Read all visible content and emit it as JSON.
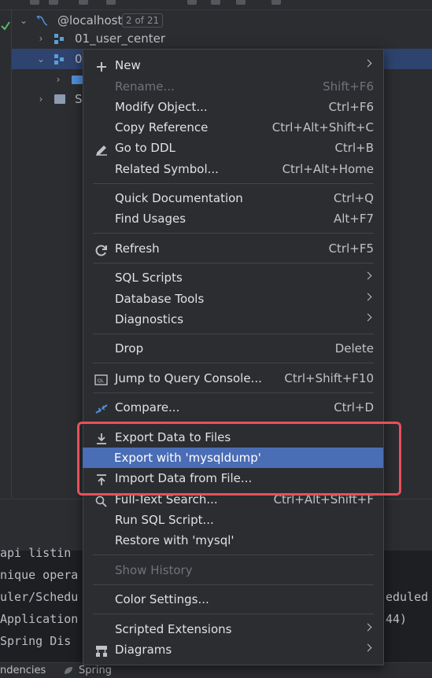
{
  "tree": {
    "datasource": {
      "name": "@localhost",
      "badge": "2 of 21"
    },
    "items": [
      {
        "label": "01_user_center"
      },
      {
        "label": "0"
      },
      {
        "label": ""
      },
      {
        "label": "S"
      }
    ]
  },
  "console": {
    "lines": [
      "  api listin",
      "nique opera",
      "uler/Schedu",
      " Application",
      "  Spring Dis"
    ],
    "right_fragments": [
      "eduled",
      "44)"
    ]
  },
  "statusbar": {
    "left_tab": "ndencies",
    "spring_tab": "Spring"
  },
  "context_menu": {
    "items": [
      {
        "label": "New",
        "shortcut": "",
        "submenu": true
      },
      {
        "label": "Rename...",
        "shortcut": "Shift+F6",
        "disabled": true
      },
      {
        "label": "Modify Object...",
        "shortcut": "Ctrl+F6"
      },
      {
        "label": "Copy Reference",
        "shortcut": "Ctrl+Alt+Shift+C"
      },
      {
        "label": "Go to DDL",
        "shortcut": "Ctrl+B"
      },
      {
        "label": "Related Symbol...",
        "shortcut": "Ctrl+Alt+Home"
      },
      {
        "label": "Quick Documentation",
        "shortcut": "Ctrl+Q"
      },
      {
        "label": "Find Usages",
        "shortcut": "Alt+F7"
      },
      {
        "label": "Refresh",
        "shortcut": "Ctrl+F5"
      },
      {
        "label": "SQL Scripts",
        "shortcut": "",
        "submenu": true
      },
      {
        "label": "Database Tools",
        "shortcut": "",
        "submenu": true
      },
      {
        "label": "Diagnostics",
        "shortcut": "",
        "submenu": true
      },
      {
        "label": "Drop",
        "shortcut": "Delete"
      },
      {
        "label": "Jump to Query Console...",
        "shortcut": "Ctrl+Shift+F10"
      },
      {
        "label": "Compare...",
        "shortcut": "Ctrl+D"
      },
      {
        "label": "Export Data to Files",
        "shortcut": ""
      },
      {
        "label": "Export with 'mysqldump'",
        "shortcut": "",
        "highlighted": true
      },
      {
        "label": "Import Data from File...",
        "shortcut": ""
      },
      {
        "label": "Full-Text Search...",
        "shortcut": "Ctrl+Alt+Shift+F"
      },
      {
        "label": "Run SQL Script...",
        "shortcut": ""
      },
      {
        "label": "Restore with 'mysql'",
        "shortcut": ""
      },
      {
        "label": "Show History",
        "shortcut": "",
        "disabled": true
      },
      {
        "label": "Color Settings...",
        "shortcut": ""
      },
      {
        "label": "Scripted Extensions",
        "shortcut": "",
        "submenu": true
      },
      {
        "label": "Diagrams",
        "shortcut": "",
        "submenu": true
      }
    ]
  },
  "colors": {
    "menu_bg": "#2b2d30",
    "highlight": "#4a6db5",
    "annotation_box": "#e8505b",
    "selected_row": "#2e436e"
  }
}
